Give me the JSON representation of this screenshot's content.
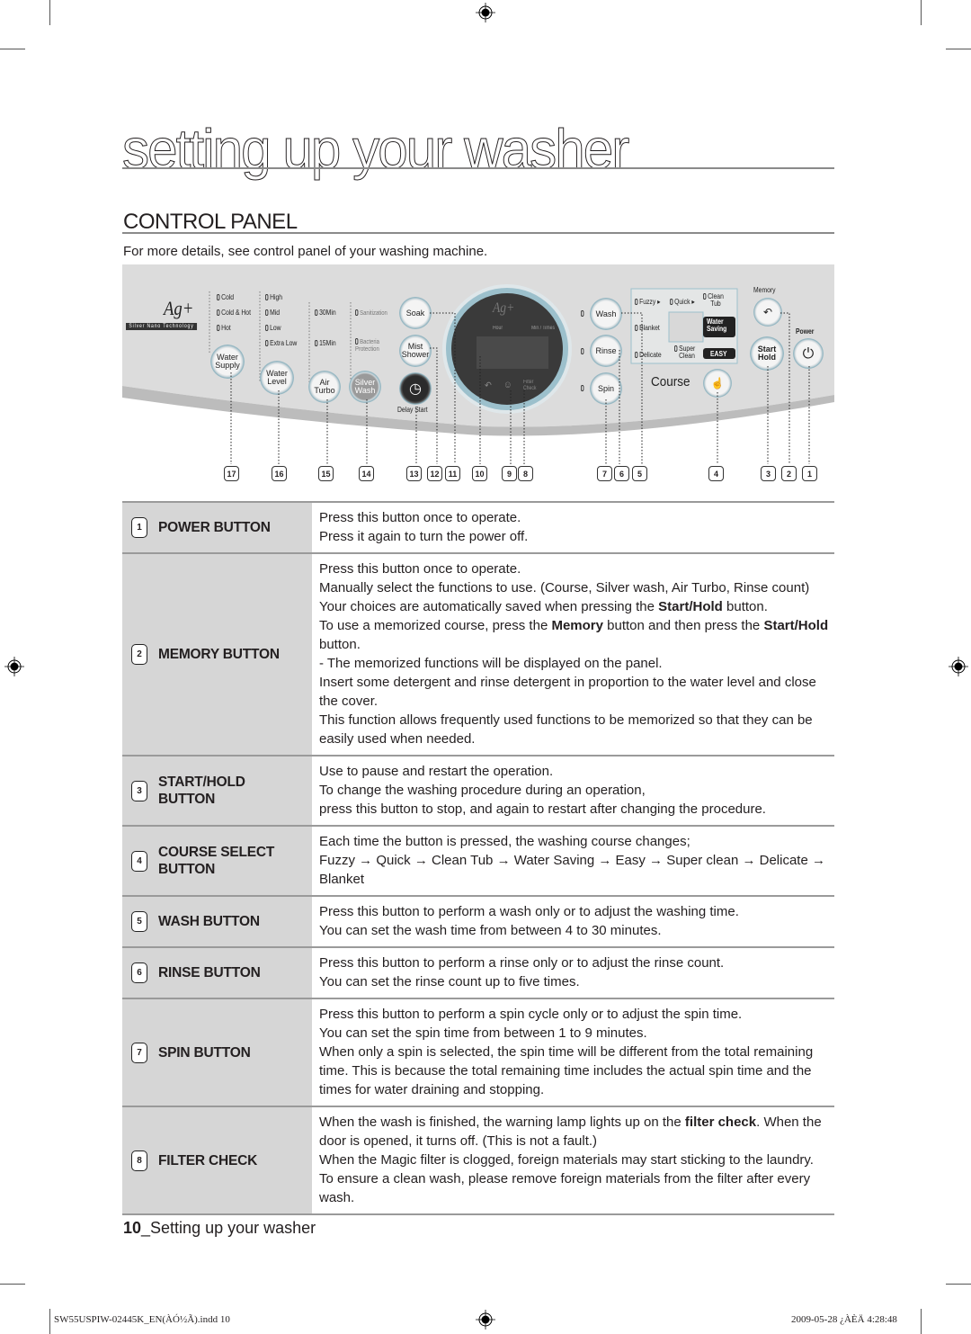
{
  "page": {
    "title": "setting up your washer",
    "section_title": "CONTROL PANEL",
    "intro": "For more details, see control panel of your washing machine."
  },
  "panel": {
    "logo_text": "Ag+",
    "logo_tagline": "Silver Nano Technology",
    "water_supply": {
      "options": [
        "Cold",
        "Cold & Hot",
        "Hot"
      ],
      "button": [
        "Water",
        "Supply"
      ]
    },
    "water_level": {
      "options": [
        "High",
        "Mid",
        "Low",
        "Extra Low"
      ],
      "button": [
        "Water",
        "Level"
      ]
    },
    "air_turbo": {
      "options": [
        "30Min",
        "15Min"
      ],
      "button": [
        "Air",
        "Turbo"
      ]
    },
    "silver_wash": {
      "options": [
        "Sanitization",
        "Bacteria Protection"
      ],
      "button": [
        "Silver",
        "Wash"
      ]
    },
    "soak_button": "Soak",
    "mist_shower_button": [
      "Mist",
      "Shower"
    ],
    "delay_start_label": "Delay Start",
    "display": {
      "logo": "Ag+",
      "hour_label": "Hour",
      "min_times_label": "Min / Times",
      "filter_check_label": [
        "Filter",
        "Check"
      ]
    },
    "wash_button": "Wash",
    "rinse_button": "Rinse",
    "spin_button": "Spin",
    "courses": {
      "fuzzy": "Fuzzy",
      "quick": "Quick",
      "clean_tub": [
        "Clean",
        "Tub"
      ],
      "water_saving": [
        "Water",
        "Saving"
      ],
      "easy": "EASY",
      "super_clean": [
        "Super",
        "Clean"
      ],
      "delicate": "Delicate",
      "blanket": "Blanket"
    },
    "course_label": "Course",
    "memory_label": "Memory",
    "power_label": "Power",
    "start_hold": [
      "Start",
      "Hold"
    ],
    "callout_numbers": [
      "17",
      "16",
      "15",
      "14",
      "13",
      "12",
      "11",
      "10",
      "9",
      "8",
      "7",
      "6",
      "5",
      "4",
      "3",
      "2",
      "1"
    ]
  },
  "table": [
    {
      "num": "1",
      "label": [
        "POWER BUTTON"
      ],
      "lines": [
        "Press this button once to operate.",
        "Press it again to turn the power off."
      ]
    },
    {
      "num": "2",
      "label": [
        "MEMORY BUTTON"
      ],
      "lines": [
        "Press this button once to operate.",
        "Manually select the functions to use. (Course, Silver wash, Air Turbo, Rinse count)",
        "Your choices are automatically saved when pressing the **Start/Hold** button.",
        "To use a memorized course, press the **Memory** button and then press the **Start/Hold** button.",
        "- The memorized functions will be displayed on the panel.",
        "Insert some detergent and rinse detergent in proportion to the water level and close the cover.",
        "This function allows frequently used functions to be memorized so that they can be easily used when needed."
      ]
    },
    {
      "num": "3",
      "label": [
        "START/HOLD",
        "BUTTON"
      ],
      "lines": [
        "Use to pause and restart the operation.",
        "To change the washing procedure during an operation,",
        "press this button to stop, and again to restart after changing the procedure."
      ]
    },
    {
      "num": "4",
      "label": [
        "COURSE SELECT",
        "BUTTON"
      ],
      "lines": [
        "Each time the button is pressed, the washing course changes;",
        "Fuzzy → Quick → Clean Tub → Water Saving → Easy → Super clean → Delicate → Blanket"
      ]
    },
    {
      "num": "5",
      "label": [
        "WASH BUTTON"
      ],
      "lines": [
        "Press this button to perform a wash only or to adjust the washing time.",
        "You can set the wash time from between 4 to 30 minutes."
      ]
    },
    {
      "num": "6",
      "label": [
        "RINSE BUTTON"
      ],
      "lines": [
        "Press this button to perform a rinse only or to adjust the rinse count.",
        "You can set the rinse count up to five times."
      ]
    },
    {
      "num": "7",
      "label": [
        "SPIN BUTTON"
      ],
      "lines": [
        "Press this button to perform a spin cycle only or to adjust the spin time.",
        "You can set the spin time from between 1 to 9 minutes.",
        "When only a spin is selected, the spin time will be different from the total remaining time. This is because the total remaining time includes the actual spin time and the times for water draining and stopping."
      ]
    },
    {
      "num": "8",
      "label": [
        "FILTER CHECK"
      ],
      "lines": [
        "When the wash is finished, the warning lamp lights up on the **filter check**. When the door is opened, it turns off. (This is not a fault.)",
        "When the Magic filter is clogged, foreign materials may start sticking to the laundry. To ensure a clean wash, please remove foreign materials from the filter after every wash."
      ]
    }
  ],
  "footer": {
    "page_number": "10",
    "page_label": "_Setting up your washer",
    "slug_left": "SW55USPIW-02445K_EN(ÀÓ½Ã).indd   10",
    "slug_right": "2009-05-28   ¿ÀÈÄ 4:28:48"
  }
}
